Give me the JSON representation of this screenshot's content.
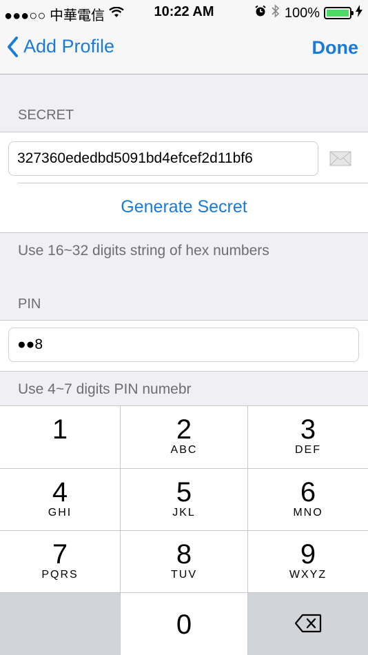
{
  "status_bar": {
    "carrier": "●●●○○ 中華電信",
    "time": "10:22 AM",
    "battery": "100%"
  },
  "nav": {
    "back_label": "Add Profile",
    "done_label": "Done"
  },
  "secret": {
    "header": "SECRET",
    "value": "327360ededbd5091bd4efcef2d11bf6",
    "generate_label": "Generate Secret",
    "hint": "Use 16~32 digits string of hex numbers"
  },
  "pin": {
    "header": "PIN",
    "value": "●●8",
    "hint": "Use 4~7 digits PIN numebr"
  },
  "keypad": {
    "keys": [
      {
        "digit": "1",
        "letters": ""
      },
      {
        "digit": "2",
        "letters": "ABC"
      },
      {
        "digit": "3",
        "letters": "DEF"
      },
      {
        "digit": "4",
        "letters": "GHI"
      },
      {
        "digit": "5",
        "letters": "JKL"
      },
      {
        "digit": "6",
        "letters": "MNO"
      },
      {
        "digit": "7",
        "letters": "PQRS"
      },
      {
        "digit": "8",
        "letters": "TUV"
      },
      {
        "digit": "9",
        "letters": "WXYZ"
      },
      {
        "digit": "0",
        "letters": ""
      }
    ]
  },
  "colors": {
    "accent": "#1a7ad9",
    "battery_fill": "#4cd964"
  },
  "icons": [
    "wifi-icon",
    "alarm-icon",
    "bluetooth-icon",
    "battery-icon",
    "charging-icon",
    "chevron-left-icon",
    "mail-icon",
    "backspace-icon"
  ]
}
